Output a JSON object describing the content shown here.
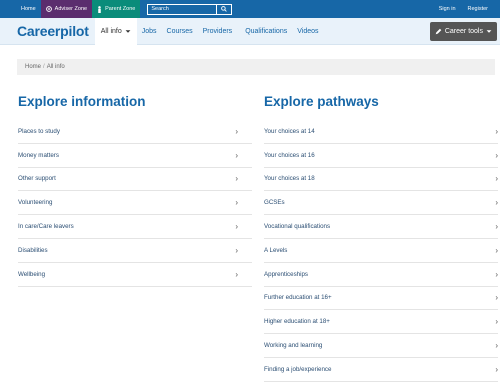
{
  "topbar": {
    "home": "Home",
    "adviser_zone": "Adviser Zone",
    "parent_zone": "Parent Zone",
    "search_placeholder": "Search",
    "sign_in": "Sign in",
    "register": "Register"
  },
  "navbar": {
    "brand": "Careerpilot",
    "items": [
      {
        "label": "All info"
      },
      {
        "label": "Jobs"
      },
      {
        "label": "Courses"
      },
      {
        "label": "Providers"
      },
      {
        "label": "Qualifications"
      },
      {
        "label": "Videos"
      }
    ],
    "career_tools": "Career tools"
  },
  "breadcrumb": {
    "home": "Home",
    "separator": "/",
    "current": "All info"
  },
  "explore_information": {
    "heading": "Explore information",
    "items": [
      "Places to study",
      "Money matters",
      "Other support",
      "Volunteering",
      "In care/Care leavers",
      "Disabilities",
      "Wellbeing"
    ]
  },
  "explore_pathways": {
    "heading": "Explore pathways",
    "items": [
      "Your choices at 14",
      "Your choices at 16",
      "Your choices at 18",
      "GCSEs",
      "Vocational qualifications",
      "A Levels",
      "Apprenticeships",
      "Further education at 16+",
      "Higher education at 18+",
      "Working and learning",
      "Finding a job/experience"
    ]
  },
  "icons": {
    "chevron": "chevron-right-icon",
    "search": "search-icon",
    "adviser": "adviser-icon",
    "parent": "parent-icon",
    "pencil": "pencil-icon",
    "caret": "caret-down-icon"
  },
  "colors": {
    "primary": "#1767a7",
    "adviser": "#5b2d6e",
    "parent": "#0a8c7a",
    "tools": "#555555"
  }
}
